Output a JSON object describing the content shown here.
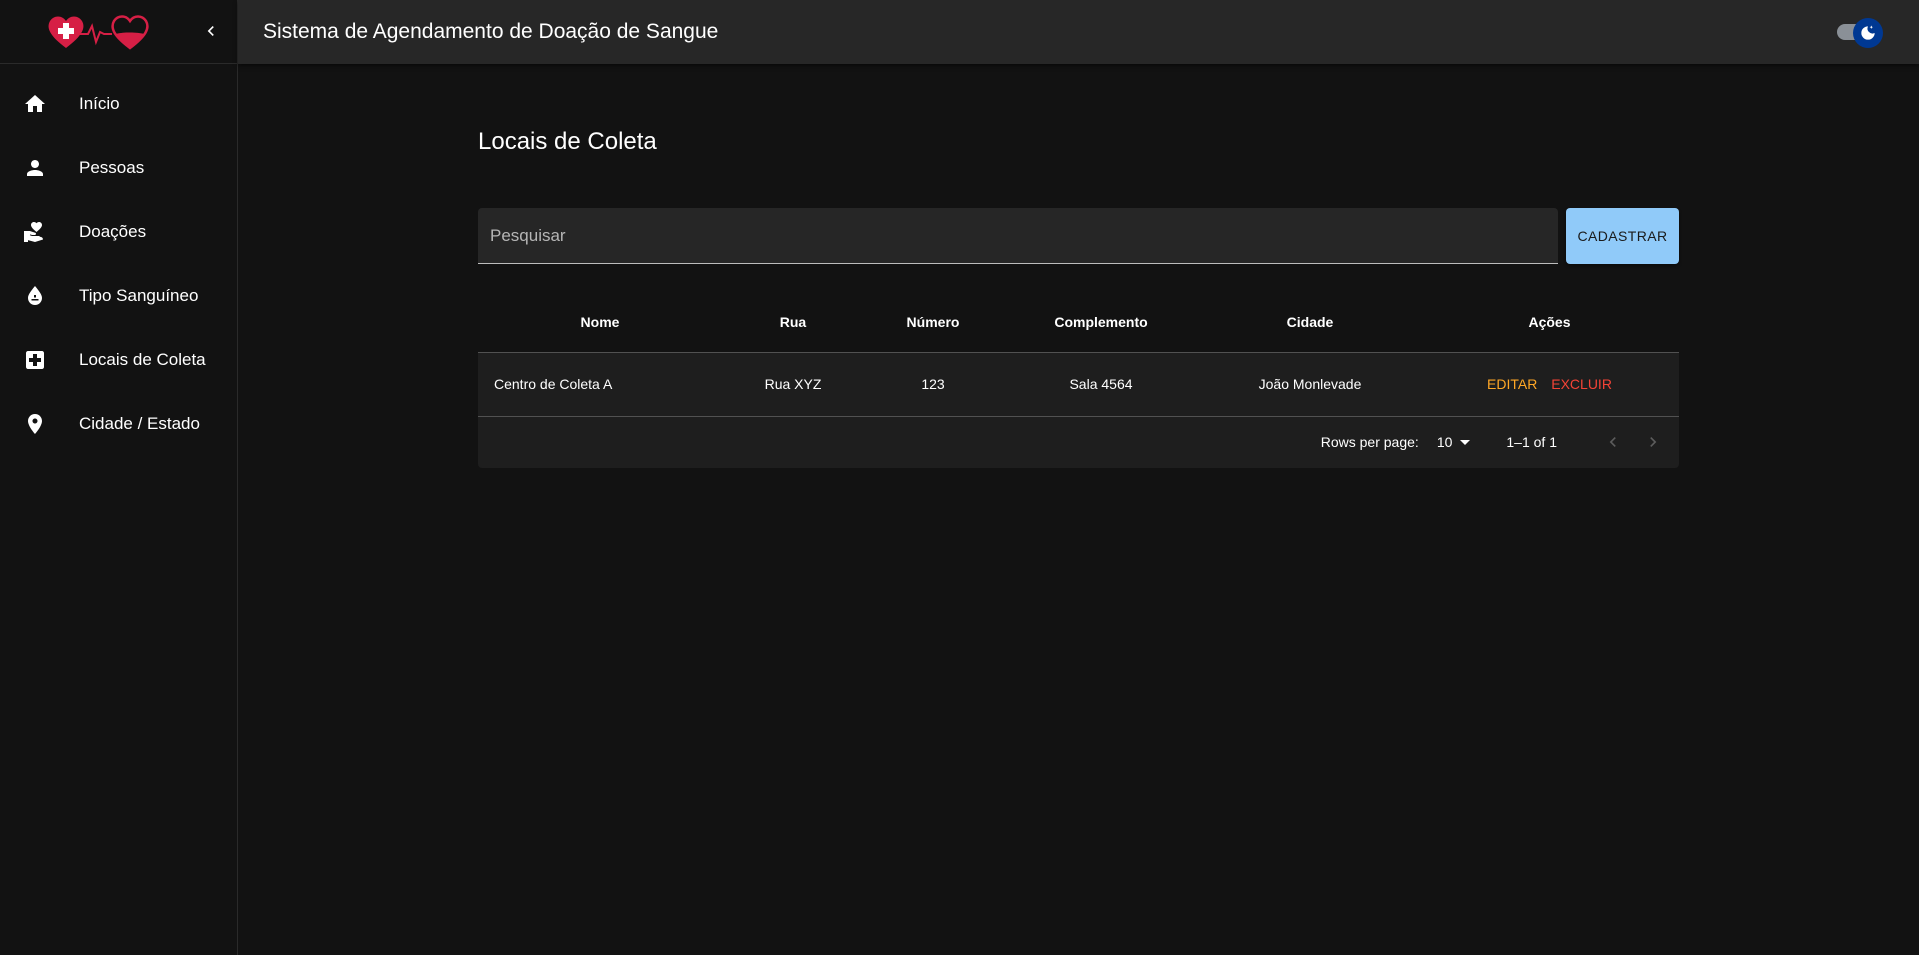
{
  "app": {
    "title": "Sistema de Agendamento de Doação de Sangue",
    "logo": "heart-cross-heartbeat-logo",
    "accent_color": "#d61f45"
  },
  "sidebar": {
    "collapse_icon": "chevron-left-icon",
    "items": [
      {
        "label": "Início",
        "icon": "home-icon"
      },
      {
        "label": "Pessoas",
        "icon": "person-icon"
      },
      {
        "label": "Doações",
        "icon": "hand-heart-icon"
      },
      {
        "label": "Tipo Sanguíneo",
        "icon": "blood-drop-icon"
      },
      {
        "label": "Locais de Coleta",
        "icon": "medical-cross-icon"
      },
      {
        "label": "Cidade / Estado",
        "icon": "location-pin-icon"
      }
    ]
  },
  "theme_toggle": {
    "state": "dark",
    "icon": "moon-icon",
    "thumb_color": "#003892"
  },
  "page": {
    "title": "Locais de Coleta",
    "search_placeholder": "Pesquisar",
    "add_button": "CADASTRAR",
    "add_button_color": "#90caf9"
  },
  "table": {
    "columns": [
      "Nome",
      "Rua",
      "Número",
      "Complemento",
      "Cidade",
      "Ações"
    ],
    "rows": [
      {
        "nome": "Centro de Coleta A",
        "rua": "Rua XYZ",
        "numero": "123",
        "complemento": "Sala 4564",
        "cidade": "João Monlevade",
        "edit": "EDITAR",
        "delete": "EXCLUIR"
      }
    ],
    "edit_color": "#ffa726",
    "delete_color": "#f44336"
  },
  "pagination": {
    "rows_per_page_label": "Rows per page:",
    "rows_per_page": "10",
    "range": "1–1 of 1",
    "prev_icon": "chevron-left-icon",
    "next_icon": "chevron-right-icon"
  }
}
